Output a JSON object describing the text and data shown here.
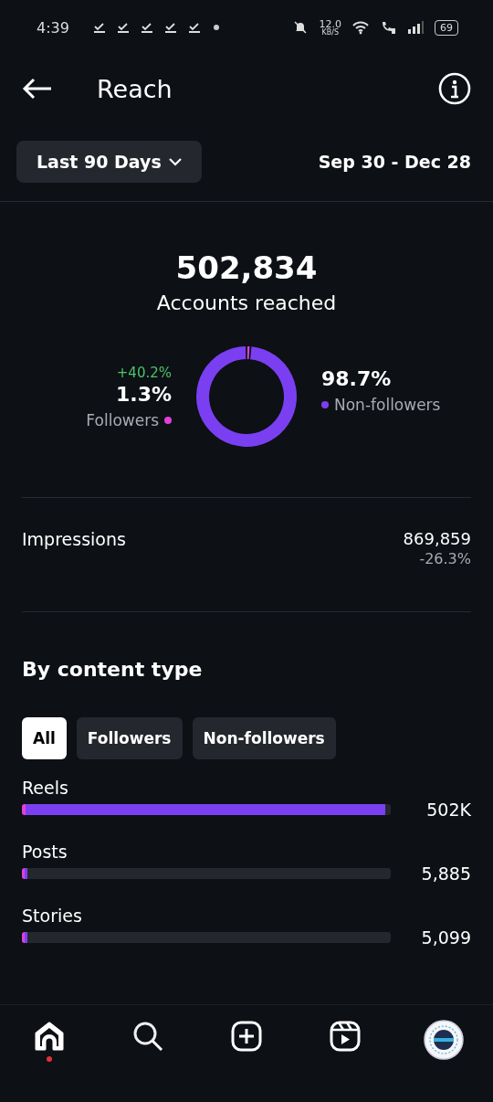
{
  "status_bar": {
    "time": "4:39",
    "speed": "12.0",
    "speed_unit": "KB/S",
    "battery": "69"
  },
  "header": {
    "title": "Reach"
  },
  "period": {
    "label": "Last 90 Days",
    "range": "Sep 30 - Dec 28"
  },
  "summary": {
    "value": "502,834",
    "label": "Accounts reached"
  },
  "audience": {
    "followers_change": "+40.2%",
    "legend": [
      {
        "share": "1.3%",
        "label": "Followers",
        "color": "#e040d8"
      },
      {
        "share": "98.7%",
        "label": "Non-followers",
        "color": "#7b3ff2"
      }
    ],
    "chart_data": {
      "type": "donut",
      "values": [
        1.3,
        98.7
      ]
    }
  },
  "impressions": {
    "label": "Impressions",
    "value": "869,859",
    "change": "-26.3%"
  },
  "content_type": {
    "title": "By content type",
    "filters": [
      {
        "label": "All",
        "selected": true
      },
      {
        "label": "Followers",
        "selected": false
      },
      {
        "label": "Non-followers",
        "selected": false
      }
    ],
    "rows": [
      {
        "label": "Reels",
        "value": "502K",
        "segments": [
          {
            "color": "#e040d8",
            "level": 0.01
          },
          {
            "color": "#7b3ff2",
            "level": 0.975
          }
        ]
      },
      {
        "label": "Posts",
        "value": "5,885",
        "segments": [
          {
            "color": "#e040d8",
            "level": 0.004
          },
          {
            "color": "#7b3ff2",
            "level": 0.008
          }
        ]
      },
      {
        "label": "Stories",
        "value": "5,099",
        "segments": [
          {
            "color": "#e040d8",
            "level": 0.005
          },
          {
            "color": "#7b3ff2",
            "level": 0.005
          }
        ]
      }
    ]
  },
  "nav": [
    {
      "kind": "home",
      "selected": true,
      "badge": true
    },
    {
      "kind": "search",
      "selected": false,
      "badge": false
    },
    {
      "kind": "create",
      "selected": false,
      "badge": false
    },
    {
      "kind": "reels",
      "selected": false,
      "badge": false
    },
    {
      "kind": "profile",
      "selected": false,
      "badge": false
    }
  ]
}
